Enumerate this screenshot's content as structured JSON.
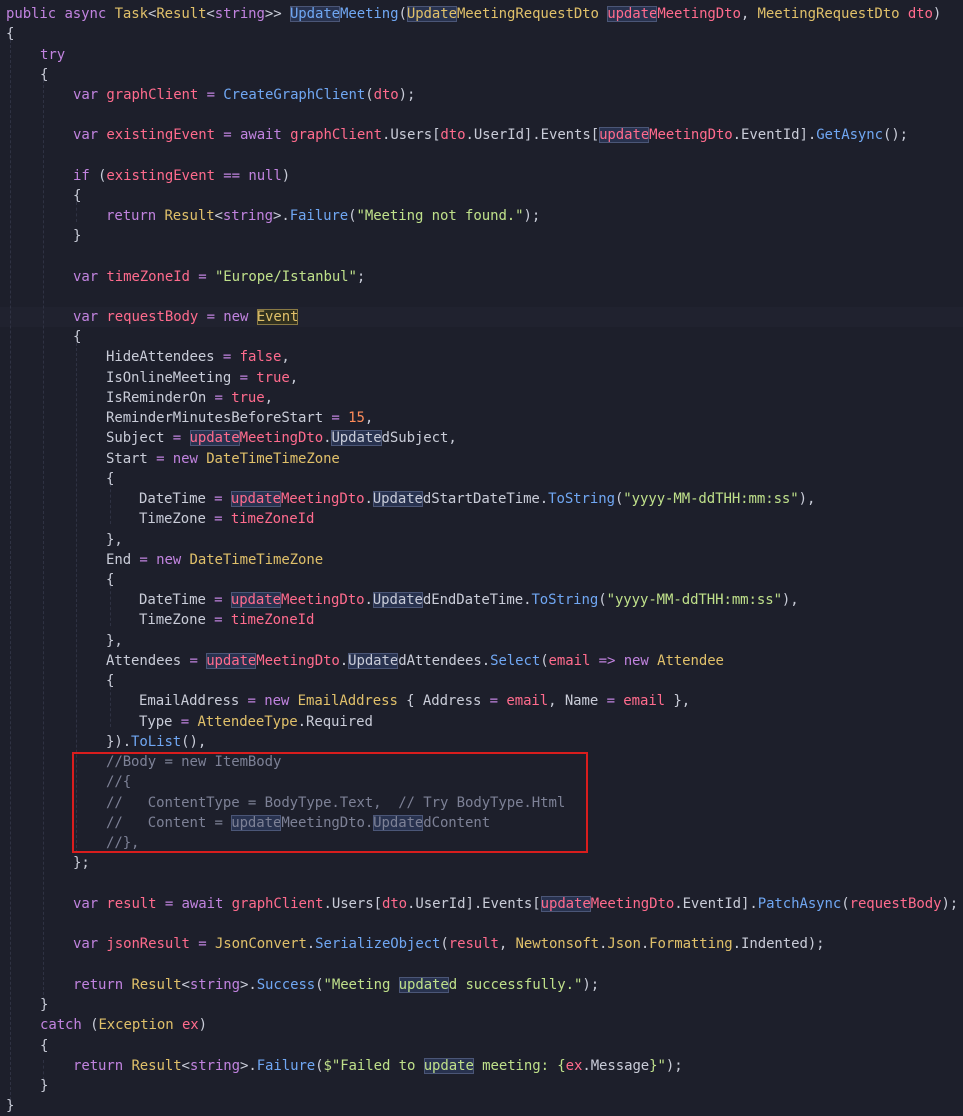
{
  "editor": {
    "language": "csharp",
    "theme_colors": {
      "background": "#1d1f2b",
      "keyword": "#c183df",
      "type": "#e0c06a",
      "variable": "#ff6b8d",
      "function": "#70a7f3",
      "string": "#bfe08a",
      "number": "#ff8c5a",
      "comment": "#7d8196",
      "highlight_box_border": "#d91d1d"
    },
    "search_highlight_term": "update",
    "highlighted_block_lines": [
      38,
      39,
      40,
      41,
      42
    ]
  },
  "code": {
    "l1": {
      "kw_public": "public",
      "kw_async": "async",
      "type_task": "Task",
      "lt1": "<",
      "type_result": "Result",
      "lt2": "<",
      "kw_string": "string",
      "gt": ">>",
      "space1": " ",
      "fn_hl": "Update",
      "fn_rest": "Meeting",
      "paren_open": "(",
      "param_type_hl": "Update",
      "param_type_rest": "MeetingRequestDto",
      "space2": " ",
      "param_name_hl": "update",
      "param_name_rest": "MeetingDto",
      "comma": ", ",
      "param2_type": "MeetingRequestDto",
      "space3": " ",
      "param2_name": "dto",
      "paren_close": ")"
    },
    "l2": "{",
    "l3": "try",
    "l4": "{",
    "l5": {
      "kw_var": "var",
      "name": "graphClient",
      "eq": " = ",
      "fn": "CreateGraphClient",
      "open": "(",
      "arg": "dto",
      "close": ");"
    },
    "l6": {
      "kw_var": "var",
      "name": "existingEvent",
      "eq": " = ",
      "kw_await": "await",
      "obj": "graphClient",
      "dot1": ".",
      "prop_users": "Users",
      "br1": "[",
      "dto": "dto",
      "dot2": ".",
      "userid": "UserId",
      "br2": "].",
      "events": "Events",
      "br3": "[",
      "u_hl": "update",
      "u_rest": "MeetingDto",
      "dot3": ".",
      "eventid": "EventId",
      "br4": "].",
      "fn": "GetAsync",
      "end": "();"
    },
    "l7": {
      "kw_if": "if",
      "open": " (",
      "name": "existingEvent",
      "op": " == ",
      "kw_null": "null",
      "close": ")"
    },
    "l8": "{",
    "l9": {
      "kw_return": "return",
      "type_result": "Result",
      "lt": "<",
      "kw_string": "string",
      "gt": ">.",
      "fn": "Failure",
      "open": "(",
      "str": "\"Meeting not found.\"",
      "close": ");"
    },
    "l10": "}",
    "l11": {
      "kw_var": "var",
      "name": "timeZoneId",
      "eq": " = ",
      "str": "\"Europe/Istanbul\"",
      "end": ";"
    },
    "l12": {
      "kw_var": "var",
      "name": "requestBody",
      "eq": " = ",
      "kw_new": "new",
      "type": "Event"
    },
    "l13": "{",
    "l14": {
      "prop": "HideAttendees",
      "eq": " = ",
      "val": "false",
      "end": ","
    },
    "l15": {
      "prop": "IsOnlineMeeting",
      "eq": " = ",
      "val": "true",
      "end": ","
    },
    "l16": {
      "prop": "IsReminderOn",
      "eq": " = ",
      "val": "true",
      "end": ","
    },
    "l17": {
      "prop": "ReminderMinutesBeforeStart",
      "eq": " = ",
      "val": "15",
      "end": ","
    },
    "l18": {
      "prop": "Subject",
      "eq": " = ",
      "u_hl": "update",
      "u_rest": "MeetingDto",
      "dot": ".",
      "p_hl": "Update",
      "p_rest": "dSubject",
      "end": ","
    },
    "l19": {
      "prop": "Start",
      "eq": " = ",
      "kw_new": "new",
      "type": "DateTimeTimeZone"
    },
    "l20": "{",
    "l21": {
      "prop": "DateTime",
      "eq": " = ",
      "u_hl": "update",
      "u_rest": "MeetingDto",
      "dot": ".",
      "p_hl": "Update",
      "p_rest": "dStartDateTime",
      "dot2": ".",
      "fn": "ToString",
      "open": "(",
      "str": "\"yyyy-MM-ddTHH:mm:ss\"",
      "close": "),"
    },
    "l22": {
      "prop": "TimeZone",
      "eq": " = ",
      "val": "timeZoneId"
    },
    "l23": "},",
    "l24": {
      "prop": "End",
      "eq": " = ",
      "kw_new": "new",
      "type": "DateTimeTimeZone"
    },
    "l25": "{",
    "l26": {
      "prop": "DateTime",
      "eq": " = ",
      "u_hl": "update",
      "u_rest": "MeetingDto",
      "dot": ".",
      "p_hl": "Update",
      "p_rest": "dEndDateTime",
      "dot2": ".",
      "fn": "ToString",
      "open": "(",
      "str": "\"yyyy-MM-ddTHH:mm:ss\"",
      "close": "),"
    },
    "l27": {
      "prop": "TimeZone",
      "eq": " = ",
      "val": "timeZoneId"
    },
    "l28": "},",
    "l29": {
      "prop": "Attendees",
      "eq": " = ",
      "u_hl": "update",
      "u_rest": "MeetingDto",
      "dot": ".",
      "p_hl": "Update",
      "p_rest": "dAttendees",
      "dot2": ".",
      "fn": "Select",
      "open": "(",
      "lambda_param": "email",
      "arrow": " => ",
      "kw_new": "new",
      "type": "Attendee"
    },
    "l30": "{",
    "l31": {
      "prop": "EmailAddress",
      "eq": " = ",
      "kw_new": "new",
      "type": "EmailAddress",
      "open": " { ",
      "p1": "Address",
      "eq2": " = ",
      "v1": "email",
      "comma": ", ",
      "p2": "Name",
      "eq3": " = ",
      "v2": "email",
      "close": " },"
    },
    "l32": {
      "prop": "Type",
      "eq": " = ",
      "type": "AttendeeType",
      "dot": ".",
      "member": "Required"
    },
    "l33": {
      "close": "}).",
      "fn": "ToList",
      "end": "(),"
    },
    "l34": "//Body = new ItemBody",
    "l35": "//{",
    "l36": "//   ContentType = BodyType.Text,  // Try BodyType.Html",
    "l37": {
      "pre": "//   Content = ",
      "u_hl": "update",
      "u_rest": "MeetingDto.",
      "p_hl": "Update",
      "p_rest": "dContent"
    },
    "l38": "//},",
    "l39": "};",
    "l40": {
      "kw_var": "var",
      "name": "result",
      "eq": " = ",
      "kw_await": "await",
      "obj": "graphClient",
      "dot1": ".",
      "users": "Users",
      "br1": "[",
      "dto": "dto",
      "dot2": ".",
      "userid": "UserId",
      "br2": "].",
      "events": "Events",
      "br3": "[",
      "u_hl": "update",
      "u_rest": "MeetingDto",
      "dot3": ".",
      "eventid": "EventId",
      "br4": "].",
      "fn": "PatchAsync",
      "open": "(",
      "arg": "requestBody",
      "close": ");"
    },
    "l41": {
      "kw_var": "var",
      "name": "jsonResult",
      "eq": " = ",
      "type": "JsonConvert",
      "dot": ".",
      "fn": "SerializeObject",
      "open": "(",
      "arg1": "result",
      "comma": ", ",
      "ns1": "Newtonsoft",
      "dot2": ".",
      "ns2": "Json",
      "dot3": ".",
      "ns3": "Formatting",
      "dot4": ".",
      "member": "Indented",
      "close": ");"
    },
    "l42": {
      "kw_return": "return",
      "type": "Result",
      "lt": "<",
      "kw_string": "string",
      "gt": ">.",
      "fn": "Success",
      "open": "(",
      "str1": "\"Meeting ",
      "str_hl": "update",
      "str2": "d successfully.\"",
      "close": ");"
    },
    "l43": "}",
    "l44": {
      "kw_catch": "catch",
      "open": " (",
      "type": "Exception",
      "sp": " ",
      "var": "ex",
      "close": ")"
    },
    "l45": "{",
    "l46": {
      "kw_return": "return",
      "type": "Result",
      "lt": "<",
      "kw_string": "string",
      "gt": ">.",
      "fn": "Failure",
      "open": "(",
      "str1": "$\"Failed to ",
      "str_hl": "update",
      "str2": " meeting: {",
      "ex": "ex",
      "dot": ".",
      "msg": "Message",
      "str3": "}\"",
      "close": ");"
    },
    "l47": "}",
    "l48": "}"
  }
}
